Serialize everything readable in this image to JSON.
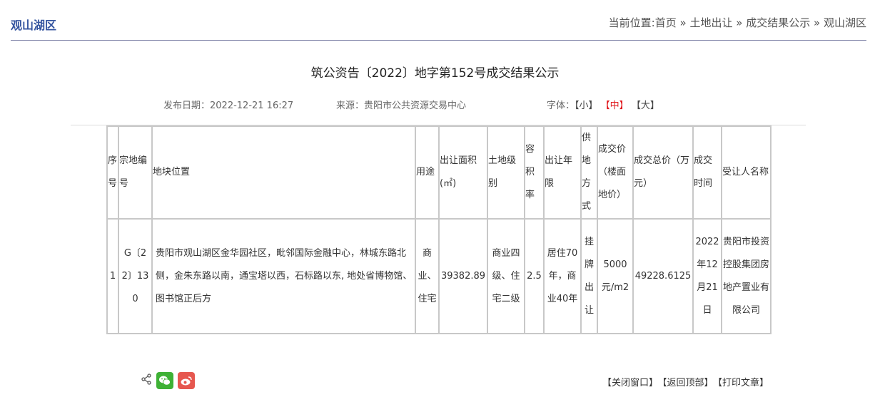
{
  "header": {
    "section_title": "观山湖区",
    "breadcrumb": {
      "prefix": "当前位置:",
      "items": [
        "首页",
        "土地出让",
        "成交结果公示",
        "观山湖区"
      ],
      "separator": "»"
    }
  },
  "article": {
    "title": "筑公资告〔2022〕地字第152号成交结果公示",
    "publish_date": "发布日期：2022-12-21 16:27",
    "source": "来源：贵阳市公共资源交易中心",
    "font_label": "字体：",
    "font_sizes": {
      "small": "【小】",
      "medium": "【中】",
      "large": "【大】"
    }
  },
  "table": {
    "headers": [
      "序号",
      "宗地编号",
      "地块位置",
      "用途",
      "出让面积(㎡)",
      "土地级别",
      "容积率",
      "出让年限",
      "供地方式",
      "成交价（楼面地价）",
      "成交总价（万元）",
      "成交时间",
      "受让人名称"
    ],
    "rows": [
      [
        "1",
        "G〔22〕130",
        "贵阳市观山湖区金华园社区，毗邻国际金融中心，林城东路北侧，金朱东路以南，通宝塔以西，石标路以东, 地处省博物馆、图书馆正后方",
        "商业、住宅",
        "39382.89",
        "商业四级、住宅二级",
        "2.5",
        "居住70年，商业40年",
        "挂牌出让",
        "5000元/m2",
        "49228.6125",
        "2022年12月21日",
        "贵阳市投资控股集团房地产置业有限公司"
      ]
    ]
  },
  "footer": {
    "share_icons": [
      "share-icon",
      "wechat-icon",
      "weibo-icon"
    ],
    "close_window": "【关闭窗口】",
    "back_to_top": "【返回顶部】",
    "print": "【打印文章】"
  },
  "colors": {
    "accent": "#34549f",
    "active_font": "#e0161b",
    "wechat": "#3eb135",
    "weibo": "#e6574f"
  }
}
